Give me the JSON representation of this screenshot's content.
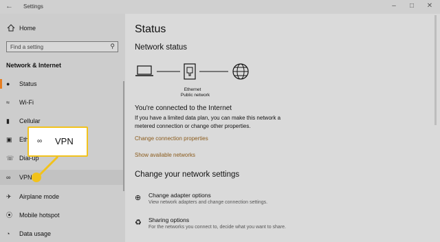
{
  "window": {
    "title": "Settings"
  },
  "sidebar": {
    "home": "Home",
    "search_placeholder": "Find a setting",
    "section": "Network & Internet",
    "items": [
      {
        "label": "Status",
        "icon": "status-icon",
        "active": true
      },
      {
        "label": "Wi-Fi",
        "icon": "wifi-icon"
      },
      {
        "label": "Cellular",
        "icon": "cellular-icon"
      },
      {
        "label": "Ethe",
        "icon": "ethernet-icon"
      },
      {
        "label": "Dial-up",
        "icon": "dialup-icon"
      },
      {
        "label": "VPN",
        "icon": "vpn-icon",
        "selected": true
      },
      {
        "label": "Airplane mode",
        "icon": "airplane-icon"
      },
      {
        "label": "Mobile hotspot",
        "icon": "hotspot-icon"
      },
      {
        "label": "Data usage",
        "icon": "data-usage-icon"
      }
    ]
  },
  "main": {
    "title": "Status",
    "network_status": "Network status",
    "diagram": {
      "caption1": "Ethernet",
      "caption2": "Public network"
    },
    "connected": "You're connected to the Internet",
    "description": "If you have a limited data plan, you can make this network a metered connection or change other properties.",
    "link_change_props": "Change connection properties",
    "link_show_networks": "Show available networks",
    "change_settings": "Change your network settings",
    "options": [
      {
        "title": "Change adapter options",
        "desc": "View network adapters and change connection settings."
      },
      {
        "title": "Sharing options",
        "desc": "For the networks you connect to, decide what you want to share."
      }
    ]
  },
  "callout": {
    "label": "VPN"
  },
  "colors": {
    "accent": "#e67e22",
    "highlight": "#f2c21b",
    "link": "#8a5a1a"
  }
}
